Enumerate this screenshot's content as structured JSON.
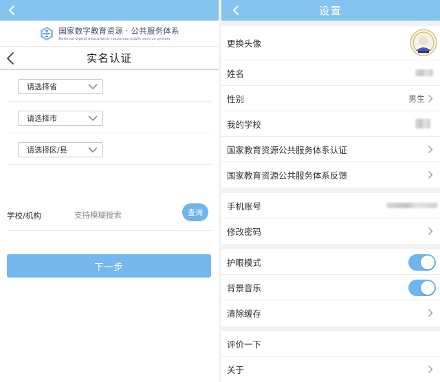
{
  "left": {
    "logo": {
      "title": "国家数字教育资源 · 公共服务体系",
      "subtitle": "National digital educational resources public service system"
    },
    "page_title": "实名认证",
    "selects": [
      {
        "placeholder": "请选择省"
      },
      {
        "placeholder": "请选择市"
      },
      {
        "placeholder": "请选择区/县"
      }
    ],
    "school": {
      "label": "学校/机构",
      "placeholder": "支持模糊搜索",
      "value": "",
      "query_label": "查询"
    },
    "next_label": "下一步"
  },
  "right": {
    "title": "设置",
    "rows": {
      "avatar": "更换头像",
      "name": "姓名",
      "gender": "性别",
      "gender_value": "男生",
      "school": "我的学校",
      "certify": "国家教育资源公共服务体系认证",
      "feedback": "国家教育资源公共服务体系反馈",
      "phone": "手机账号",
      "password": "修改密码",
      "eye_mode": "护眼模式",
      "bg_music": "背景音乐",
      "clear_cache": "清除缓存",
      "rate": "评价一下",
      "about": "关于"
    },
    "toggles": {
      "eye_mode": true,
      "bg_music": true
    }
  },
  "colors": {
    "topbar": "#84c4ef",
    "accent": "#6fb4ea",
    "toggle_on": "#6db7ec",
    "logo_text": "#3d4a6e"
  },
  "icons": [
    "back-arrow-icon",
    "logo-icon",
    "chevron-down-icon",
    "chevron-right-icon",
    "avatar-icon"
  ]
}
